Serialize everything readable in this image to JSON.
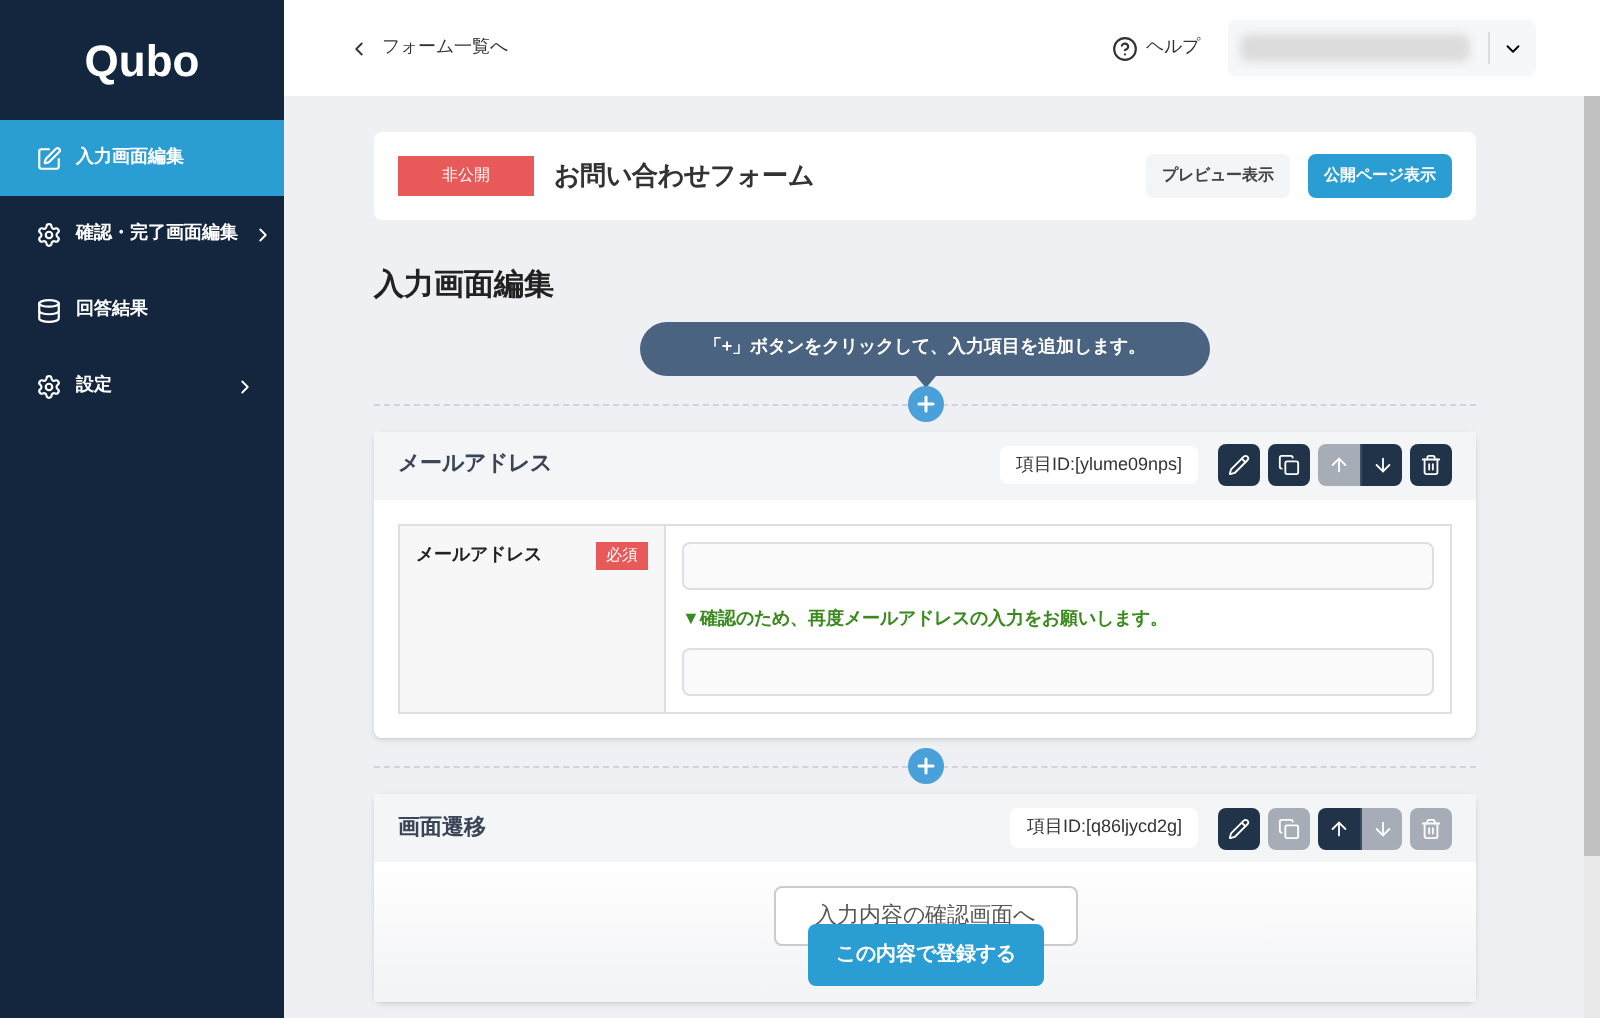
{
  "sidebar": {
    "logo": "Qubo",
    "items": [
      {
        "kind": "edit",
        "label": "入力画面編集",
        "selected": true,
        "has_submenu": false
      },
      {
        "kind": "gear",
        "label": "確認・完了画面編集",
        "selected": false,
        "has_submenu": true
      },
      {
        "kind": "database",
        "label": "回答結果",
        "selected": false,
        "has_submenu": false
      },
      {
        "kind": "gear",
        "label": "設定",
        "selected": false,
        "has_submenu": true
      }
    ]
  },
  "header": {
    "back_link": "フォーム一覧へ",
    "help": "ヘルプ"
  },
  "form_bar": {
    "status": "非公開",
    "title": "お問い合わせフォーム",
    "buttons": [
      {
        "label": "プレビュー表示",
        "primary": false
      },
      {
        "label": "公開ページ表示",
        "primary": true
      }
    ]
  },
  "section_title": "入力画面編集",
  "hint": "「+」ボタンをクリックして、入力項目を追加します。",
  "items": [
    {
      "kind": "email",
      "title": "メールアドレス",
      "item_id": "項目ID:[ylume09nps]",
      "actions": [
        {
          "kind": "edit",
          "disabled": false
        },
        {
          "kind": "copy",
          "disabled": false
        },
        {
          "kind": "up",
          "disabled": true
        },
        {
          "kind": "down",
          "disabled": false
        },
        {
          "kind": "delete",
          "disabled": false
        }
      ],
      "label": "メールアドレス",
      "required": "必須",
      "confirm_note": "▼確認のため、再度メールアドレスの入力をお願いします。"
    },
    {
      "kind": "transition",
      "title": "画面遷移",
      "item_id": "項目ID:[q86ljycd2g]",
      "actions": [
        {
          "kind": "edit",
          "disabled": false
        },
        {
          "kind": "copy",
          "disabled": true
        },
        {
          "kind": "up",
          "disabled": false
        },
        {
          "kind": "down",
          "disabled": true
        },
        {
          "kind": "delete",
          "disabled": true
        }
      ],
      "button": "入力内容の確認画面へ"
    }
  ],
  "submit": "この内容で登録する"
}
